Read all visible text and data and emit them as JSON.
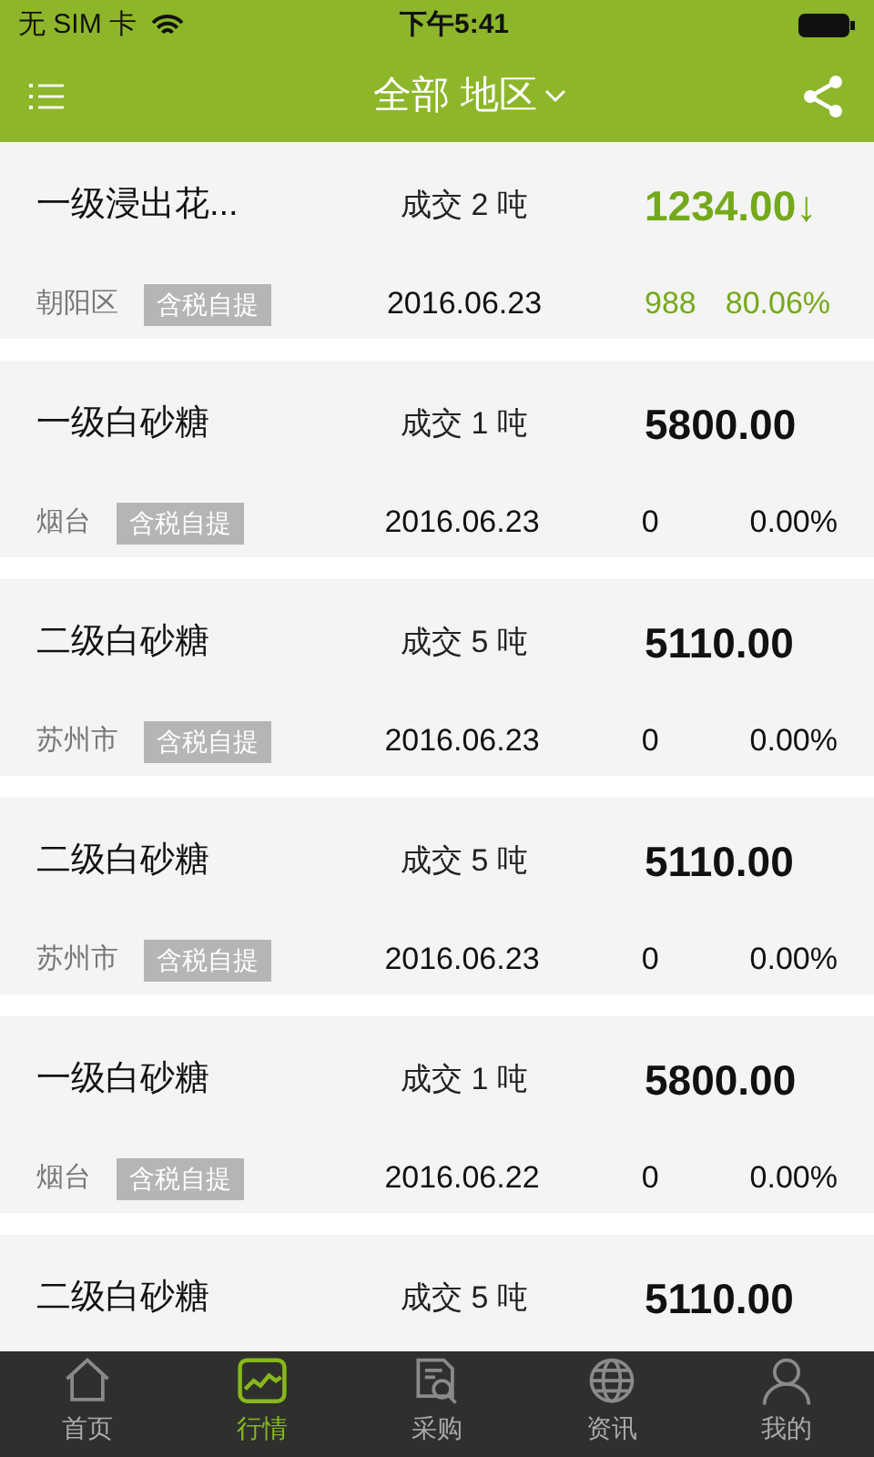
{
  "status_bar": {
    "carrier": "无 SIM 卡",
    "time": "下午5:41"
  },
  "header": {
    "title": "全部 地区"
  },
  "quotes": [
    {
      "name": "一级浸出花...",
      "deal": "成交 2 吨",
      "price": "1234.00",
      "arrow": "↓",
      "color": "#75a91b",
      "region": "朝阳区",
      "tag": "含税自提",
      "date": "2016.06.23",
      "change": "988",
      "percent": "80.06%"
    },
    {
      "name": "一级白砂糖",
      "deal": "成交 1 吨",
      "price": "5800.00",
      "color": "#111111",
      "region": "烟台",
      "tag": "含税自提",
      "date": "2016.06.23",
      "change": "0",
      "percent": "0.00%"
    },
    {
      "name": "二级白砂糖",
      "deal": "成交 5 吨",
      "price": "5110.00",
      "color": "#111111",
      "region": "苏州市",
      "tag": "含税自提",
      "date": "2016.06.23",
      "change": "0",
      "percent": "0.00%"
    },
    {
      "name": "二级白砂糖",
      "deal": "成交 5 吨",
      "price": "5110.00",
      "color": "#111111",
      "region": "苏州市",
      "tag": "含税自提",
      "date": "2016.06.23",
      "change": "0",
      "percent": "0.00%"
    },
    {
      "name": "一级白砂糖",
      "deal": "成交 1 吨",
      "price": "5800.00",
      "color": "#111111",
      "region": "烟台",
      "tag": "含税自提",
      "date": "2016.06.22",
      "change": "0",
      "percent": "0.00%"
    },
    {
      "name": "二级白砂糖",
      "deal": "成交 5 吨",
      "price": "5110.00",
      "color": "#111111"
    }
  ],
  "tab_bar": [
    {
      "label": "首页",
      "selected": false
    },
    {
      "label": "行情",
      "selected": true
    },
    {
      "label": "采购",
      "selected": false
    },
    {
      "label": "资讯",
      "selected": false
    },
    {
      "label": "我的",
      "selected": false
    }
  ]
}
